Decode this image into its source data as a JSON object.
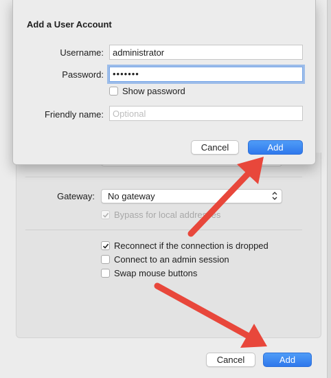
{
  "dialog": {
    "title": "Add a User Account",
    "username_label": "Username:",
    "username_value": "administrator",
    "password_label": "Password:",
    "password_dots": "•••••••",
    "show_password_label": "Show password",
    "friendly_name_label": "Friendly name:",
    "friendly_name_placeholder": "Optional",
    "cancel_label": "Cancel",
    "add_label": "Add"
  },
  "background": {
    "gateway_label": "Gateway:",
    "gateway_value": "No gateway",
    "bypass_label": "Bypass for local addresses",
    "bypass_checked": true,
    "reconnect_label": "Reconnect if the connection is dropped",
    "reconnect_checked": true,
    "admin_session_label": "Connect to an admin session",
    "admin_session_checked": false,
    "swap_mouse_label": "Swap mouse buttons",
    "swap_mouse_checked": false,
    "cancel_label": "Cancel",
    "add_label": "Add"
  },
  "colors": {
    "primary_button": "#2f78ec",
    "annotation_arrow": "#e8473b",
    "focus_ring": "#5b95e8"
  }
}
